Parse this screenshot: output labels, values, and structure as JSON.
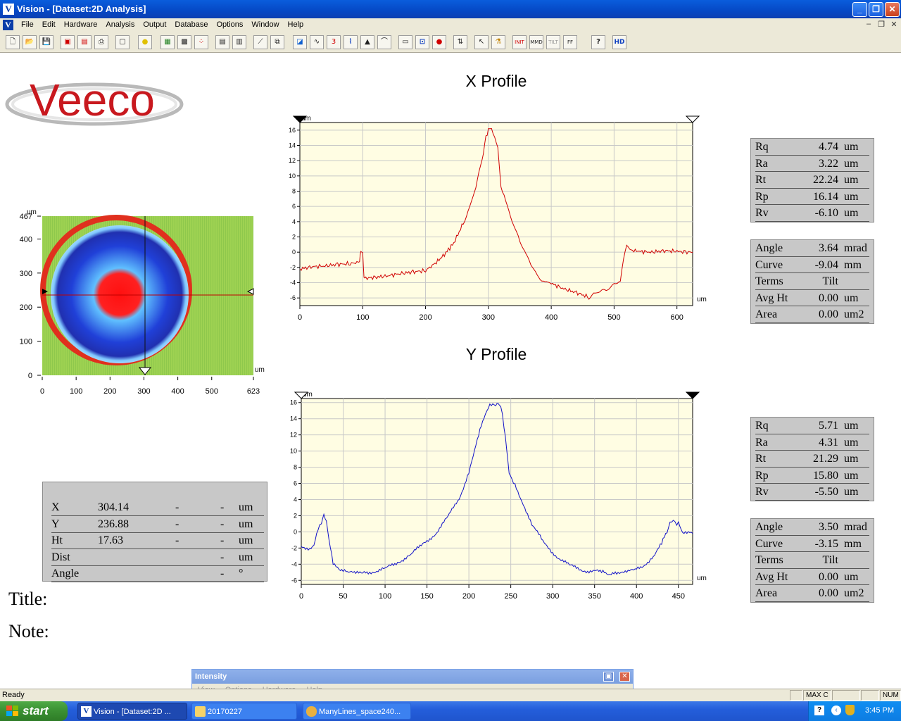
{
  "window": {
    "title": "Vision - [Dataset:2D Analysis]",
    "app_icon": "V"
  },
  "menu": [
    "File",
    "Edit",
    "Hardware",
    "Analysis",
    "Output",
    "Database",
    "Options",
    "Window",
    "Help"
  ],
  "toolbar": {
    "hd_label": "HD",
    "help_label": "?"
  },
  "logo_text": "Veeco",
  "x_profile": {
    "title": "X Profile",
    "stats": [
      {
        "label": "Rq",
        "value": "4.74",
        "unit": "um"
      },
      {
        "label": "Ra",
        "value": "3.22",
        "unit": "um"
      },
      {
        "label": "Rt",
        "value": "22.24",
        "unit": "um"
      },
      {
        "label": "Rp",
        "value": "16.14",
        "unit": "um"
      },
      {
        "label": "Rv",
        "value": "-6.10",
        "unit": "um"
      }
    ],
    "stats2": [
      {
        "label": "Angle",
        "value": "3.64",
        "unit": "mrad"
      },
      {
        "label": "Curve",
        "value": "-9.04",
        "unit": "mm"
      },
      {
        "label": "Terms",
        "value": "Tilt",
        "unit": ""
      },
      {
        "label": "Avg Ht",
        "value": "0.00",
        "unit": "um"
      },
      {
        "label": "Area",
        "value": "0.00",
        "unit": "um2"
      }
    ]
  },
  "y_profile": {
    "title": "Y Profile",
    "stats": [
      {
        "label": "Rq",
        "value": "5.71",
        "unit": "um"
      },
      {
        "label": "Ra",
        "value": "4.31",
        "unit": "um"
      },
      {
        "label": "Rt",
        "value": "21.29",
        "unit": "um"
      },
      {
        "label": "Rp",
        "value": "15.80",
        "unit": "um"
      },
      {
        "label": "Rv",
        "value": "-5.50",
        "unit": "um"
      }
    ],
    "stats2": [
      {
        "label": "Angle",
        "value": "3.50",
        "unit": "mrad"
      },
      {
        "label": "Curve",
        "value": "-3.15",
        "unit": "mm"
      },
      {
        "label": "Terms",
        "value": "Tilt",
        "unit": ""
      },
      {
        "label": "Avg Ht",
        "value": "0.00",
        "unit": "um"
      },
      {
        "label": "Area",
        "value": "0.00",
        "unit": "um2"
      }
    ]
  },
  "surface_map": {
    "unit": "um",
    "x_ticks": [
      "0",
      "100",
      "200",
      "300",
      "400",
      "500",
      "623"
    ],
    "y_ticks": [
      "0",
      "100",
      "200",
      "300",
      "400",
      "467"
    ],
    "cursor_x": 304.14,
    "cursor_y": 236.88
  },
  "cursor_info": {
    "rows": [
      {
        "label": "X",
        "value": "304.14",
        "d1": "-",
        "d2": "-",
        "unit": "um"
      },
      {
        "label": "Y",
        "value": "236.88",
        "d1": "-",
        "d2": "-",
        "unit": "um"
      },
      {
        "label": "Ht",
        "value": "17.63",
        "d1": "-",
        "d2": "-",
        "unit": "um"
      },
      {
        "label": "Dist",
        "value": "",
        "d1": "",
        "d2": "-",
        "unit": "um"
      },
      {
        "label": "Angle",
        "value": "",
        "d1": "",
        "d2": "-",
        "unit": "°"
      }
    ]
  },
  "notes": {
    "title_label": "Title:",
    "note_label": "Note:"
  },
  "status": {
    "ready": "Ready",
    "pane1": "MAX C",
    "pane2": "NUM"
  },
  "intensity": {
    "title": "Intensity",
    "menu": [
      "View",
      "Options",
      "Hardware",
      "Help"
    ]
  },
  "taskbar": {
    "start": "start",
    "tasks": [
      "Vision - [Dataset:2D ...",
      "20170227",
      "ManyLines_space240..."
    ],
    "clock": "3:45 PM"
  },
  "colors": {
    "x_series": "#d00000",
    "y_series": "#1010c8",
    "plot_bg": "#fffde3",
    "grid": "#c8c8c8"
  },
  "chart_data": [
    {
      "type": "line",
      "title": "X Profile",
      "xlabel": "um",
      "ylabel": "um",
      "xlim": [
        0,
        625
      ],
      "ylim": [
        -7,
        17
      ],
      "x_ticks": [
        0,
        100,
        200,
        300,
        400,
        500,
        600
      ],
      "y_ticks": [
        -6,
        -4,
        -2,
        0,
        2,
        4,
        6,
        8,
        10,
        12,
        14,
        16
      ],
      "series": [
        {
          "color": "#d00000",
          "x": [
            0,
            20,
            40,
            60,
            80,
            95,
            97,
            100,
            102,
            105,
            120,
            140,
            160,
            180,
            200,
            215,
            230,
            245,
            260,
            270,
            280,
            290,
            296,
            300,
            305,
            310,
            315,
            320,
            325,
            330,
            340,
            350,
            360,
            370,
            380,
            390,
            400,
            420,
            440,
            460,
            470,
            480,
            490,
            500,
            510,
            515,
            520,
            525,
            540,
            560,
            580,
            600,
            625
          ],
          "y": [
            -2.2,
            -1.9,
            -1.8,
            -1.6,
            -1.5,
            -1.3,
            0.2,
            -0.3,
            -3.2,
            -3.4,
            -3.3,
            -3.1,
            -2.8,
            -2.6,
            -2.4,
            -1.5,
            -0.3,
            1.2,
            3.8,
            6.0,
            8.5,
            12.0,
            15.2,
            15.9,
            16.1,
            15.0,
            13.5,
            8.5,
            7.5,
            6.0,
            3.8,
            1.5,
            -0.5,
            -2.0,
            -3.2,
            -3.8,
            -4.1,
            -4.8,
            -5.3,
            -5.9,
            -5.5,
            -5.2,
            -4.8,
            -4.0,
            -3.8,
            -1.0,
            1.0,
            0.3,
            0.1,
            0.0,
            0.2,
            0.1,
            0.0
          ]
        }
      ]
    },
    {
      "type": "line",
      "title": "Y Profile",
      "xlabel": "um",
      "ylabel": "um",
      "xlim": [
        0,
        467
      ],
      "ylim": [
        -6.5,
        16.5
      ],
      "x_ticks": [
        0,
        50,
        100,
        150,
        200,
        250,
        300,
        350,
        400,
        450
      ],
      "y_ticks": [
        -6,
        -4,
        -2,
        0,
        2,
        4,
        6,
        8,
        10,
        12,
        14,
        16
      ],
      "series": [
        {
          "color": "#1010c8",
          "x": [
            0,
            10,
            15,
            20,
            24,
            27,
            30,
            33,
            38,
            45,
            55,
            65,
            75,
            85,
            100,
            115,
            130,
            145,
            160,
            175,
            190,
            200,
            205,
            210,
            218,
            225,
            232,
            238,
            242,
            248,
            255,
            265,
            275,
            290,
            305,
            320,
            340,
            360,
            378,
            390,
            400,
            410,
            420,
            430,
            438,
            442,
            446,
            450,
            455,
            467
          ],
          "y": [
            -1.8,
            -2.0,
            -1.5,
            0.5,
            1.0,
            2.0,
            1.5,
            -1.0,
            -4.0,
            -4.5,
            -5.0,
            -5.2,
            -5.0,
            -4.9,
            -4.6,
            -3.8,
            -2.8,
            -1.6,
            -0.2,
            1.8,
            4.5,
            7.5,
            9.5,
            11.5,
            14.0,
            15.6,
            15.8,
            15.7,
            13.0,
            7.5,
            5.8,
            3.5,
            1.0,
            -1.5,
            -3.0,
            -4.2,
            -4.8,
            -5.0,
            -5.3,
            -5.0,
            -4.6,
            -4.0,
            -3.0,
            -1.5,
            0.5,
            1.5,
            1.2,
            1.0,
            -0.3,
            -0.2
          ]
        }
      ]
    }
  ]
}
